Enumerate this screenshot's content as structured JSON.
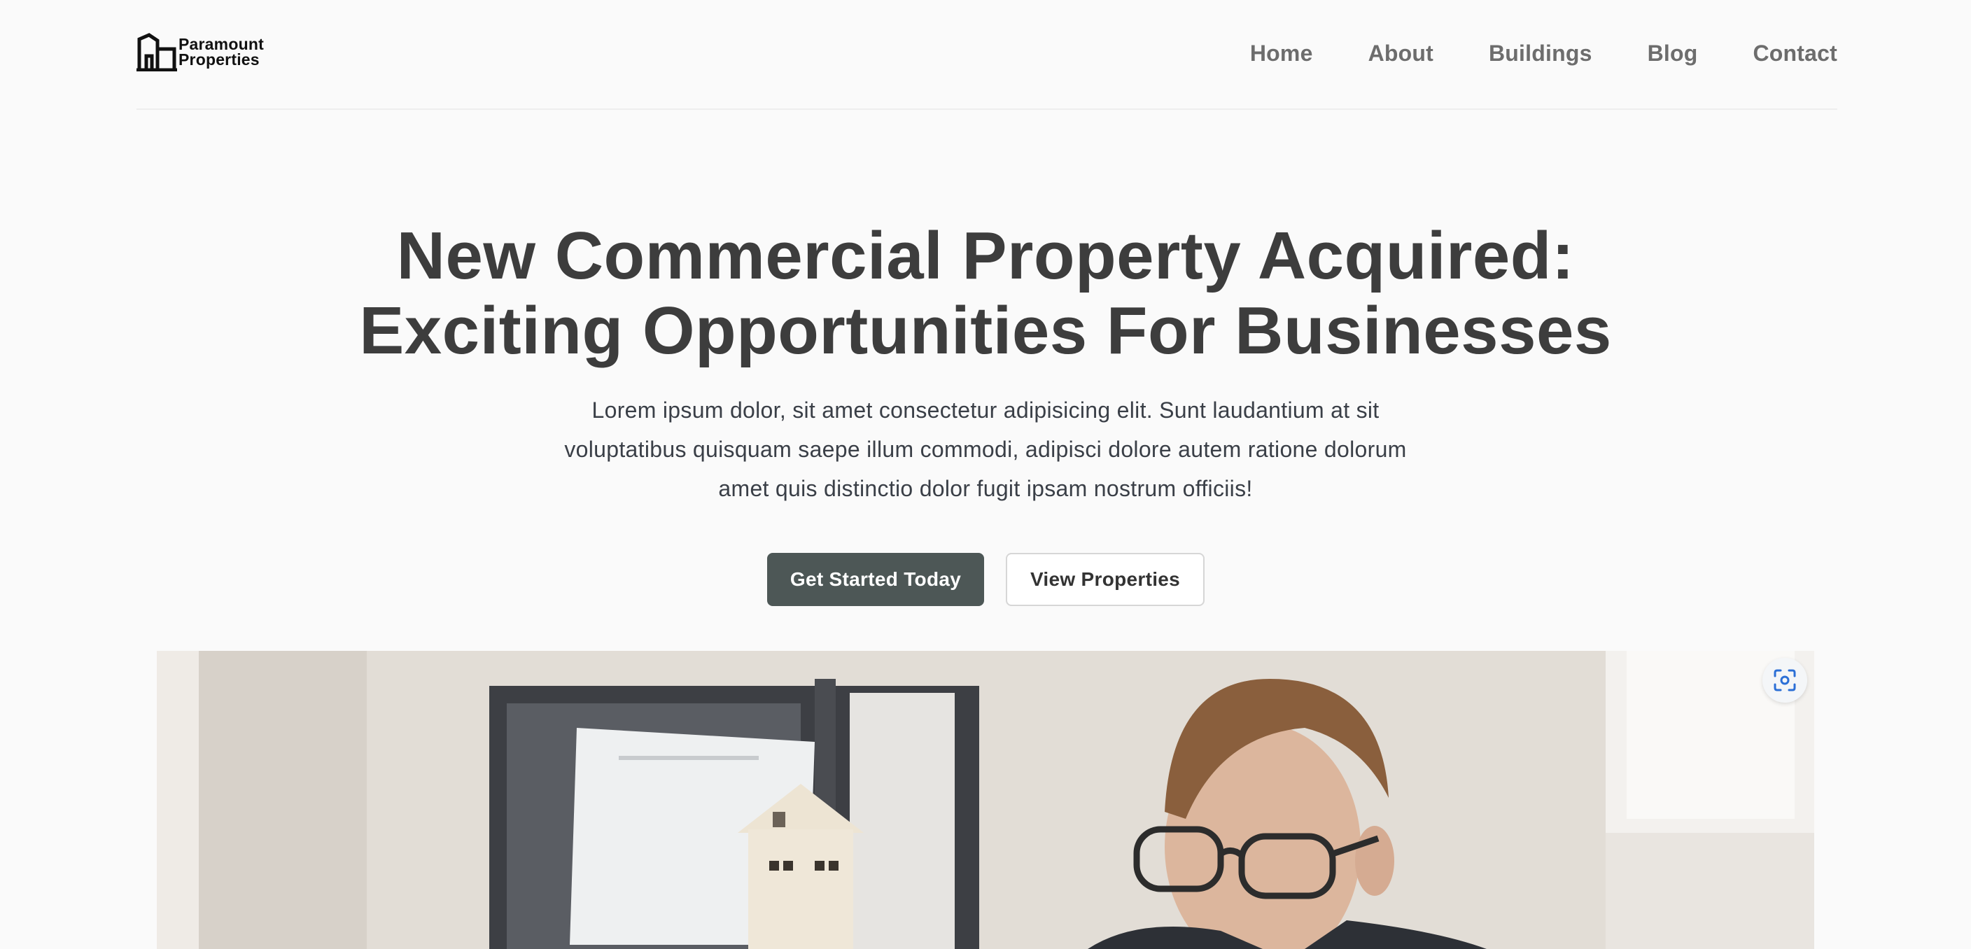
{
  "brand": {
    "name_line1": "Paramount",
    "name_line2": "Properties"
  },
  "nav": {
    "items": [
      {
        "label": "Home"
      },
      {
        "label": "About"
      },
      {
        "label": "Buildings"
      },
      {
        "label": "Blog"
      },
      {
        "label": "Contact"
      }
    ]
  },
  "hero": {
    "title_line1": "New Commercial Property Acquired:",
    "title_line2": "Exciting Opportunities For Businesses",
    "subtitle_line1": "Lorem ipsum dolor, sit amet consectetur adipisicing elit. Sunt laudantium at sit",
    "subtitle_line2": "voluptatibus quisquam saepe illum commodi, adipisci dolore autem ratione dolorum",
    "subtitle_line3": "amet quis distinctio dolor fugit ipsam nostrum officiis!",
    "primary_button": "Get Started Today",
    "secondary_button": "View Properties"
  },
  "image": {
    "icons": [
      "scan-icon"
    ]
  },
  "colors": {
    "background": "#fafafa",
    "heading": "#3d3d3d",
    "nav_text": "#6d6d6d",
    "primary_button": "#4d5756",
    "scan_icon": "#2b6fd6"
  }
}
